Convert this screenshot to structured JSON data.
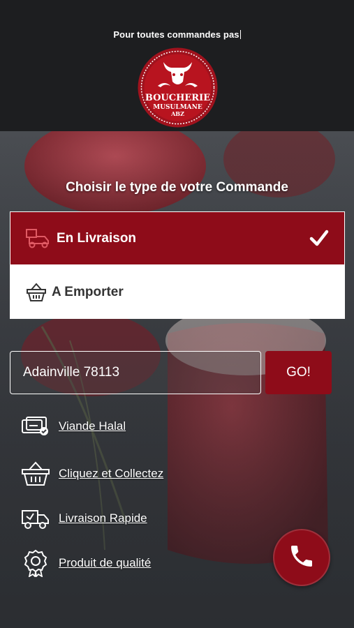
{
  "header": {
    "promo_text": "Pour toutes commandes pas",
    "logo": {
      "line1": "BOUCHERIE",
      "line2": "MUSULMANE",
      "line3": "ABZ"
    }
  },
  "order": {
    "title": "Choisir le type de votre Commande",
    "options": [
      {
        "label": "En Livraison",
        "icon": "delivery-scooter-icon",
        "selected": true
      },
      {
        "label": "A Emporter",
        "icon": "basket-icon",
        "selected": false
      }
    ]
  },
  "address": {
    "value": "Adainville 78113",
    "button_label": "GO!"
  },
  "features": [
    {
      "label": "Viande Halal",
      "icon": "card-check-icon"
    },
    {
      "label": "Cliquez et Collectez",
      "icon": "basket-icon"
    },
    {
      "label": "Livraison Rapide",
      "icon": "delivery-truck-icon"
    },
    {
      "label": "Produit de qualité",
      "icon": "quality-badge-icon"
    }
  ],
  "colors": {
    "accent": "#8e0c19",
    "header_bg": "#1d1e20"
  }
}
